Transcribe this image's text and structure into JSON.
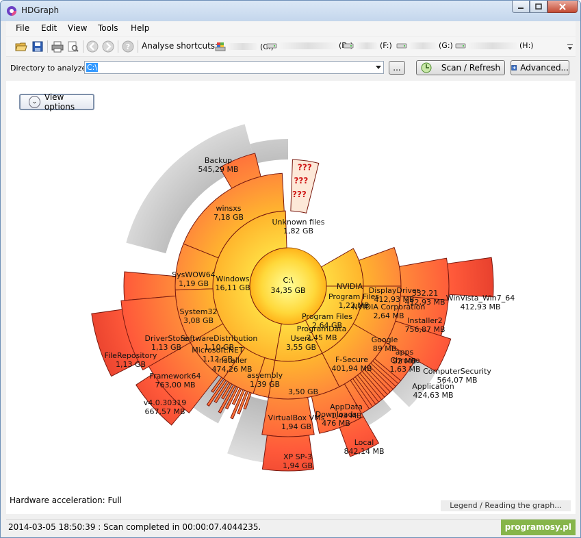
{
  "window": {
    "title": "HDGraph"
  },
  "menu": [
    "File",
    "Edit",
    "View",
    "Tools",
    "Help"
  ],
  "toolbar": {
    "shortcuts_label": "Analyse shortcuts:",
    "drives": [
      {
        "letter": "(C:)",
        "icon": "windows-drive-icon"
      },
      {
        "letter": "(D:)",
        "icon": "drive-icon"
      },
      {
        "letter": "(F:)",
        "icon": "drive-icon"
      },
      {
        "letter": "(G:)",
        "icon": "drive-icon"
      },
      {
        "letter": "(H:)",
        "icon": "drive-icon"
      }
    ]
  },
  "directory": {
    "label": "Directory to analyze :",
    "value": "C:\\",
    "browse_label": "...",
    "scan_label": "Scan / Refresh",
    "advanced_label": "Advanced..."
  },
  "view_options_label": "View options",
  "hardware_acceleration": "Hardware acceleration: Full",
  "legend_link": "Legend / Reading the graph...",
  "status": "2014-03-05 18:50:39 : Scan completed in 00:00:07.4044235.",
  "watermark": "programosy.pl",
  "graph": {
    "root": {
      "name": "C:\\",
      "size": "34,35 GB"
    },
    "labels": [
      {
        "name": "Backup",
        "size": "545,29 MB"
      },
      {
        "name": "winsxs",
        "size": "7,18 GB"
      },
      {
        "name": "Unknown files",
        "size": "1,82 GB"
      },
      {
        "name": "SysWOW64",
        "size": "1,19 GB"
      },
      {
        "name": "Windows",
        "size": "16,11 GB"
      },
      {
        "name": "System32",
        "size": "3,08 GB"
      },
      {
        "name": "DriverStore",
        "size": "1,13 GB"
      },
      {
        "name": "SoftwareDistribution",
        "size": "1,10 GB"
      },
      {
        "name": "FileRepository",
        "size": "1,13 GB"
      },
      {
        "name": "Microsoft.NET",
        "size": "1,12 GB"
      },
      {
        "name": "Installer",
        "size": "474,26 MB"
      },
      {
        "name": "Framework64",
        "size": "763,00 MB"
      },
      {
        "name": "assembly",
        "size": "1,39 GB"
      },
      {
        "name": "v4.0.30319",
        "size": "667,57 MB"
      },
      {
        "name": "Users",
        "size": "3,55 GB"
      },
      {
        "name": "",
        "size": "3,50 GB"
      },
      {
        "name": "VirtualBox VMs",
        "size": "1,94 GB"
      },
      {
        "name": "XP SP-3",
        "size": "1,94 GB"
      },
      {
        "name": "Downloads",
        "size": "476 MB"
      },
      {
        "name": "AppData",
        "size": "1,43 MB"
      },
      {
        "name": "Local",
        "size": "842,14 MB"
      },
      {
        "name": "Program Files",
        "size": "2,64 GB"
      },
      {
        "name": "ProgramData",
        "size": "2,45 MB"
      },
      {
        "name": "F-Secure",
        "size": "401,94 MB"
      },
      {
        "name": "Google",
        "size": "89 MB"
      },
      {
        "name": "Chrome",
        "size": "1,63 MB"
      },
      {
        "name": "apps",
        "size": "92 MB"
      },
      {
        "name": "ComputerSecurity",
        "size": "564,07 MB"
      },
      {
        "name": "Application",
        "size": "424,63 MB"
      },
      {
        "name": "NVIDIA Corporation",
        "size": "2,64 MB"
      },
      {
        "name": "Installer2",
        "size": "756,87 MB"
      },
      {
        "name": "NVIDIA",
        "size": ""
      },
      {
        "name": "Program Files",
        "size": "1,22 MB"
      },
      {
        "name": "DisplayDriver",
        "size": "412,93 MB"
      },
      {
        "name": "332.21",
        "size": "412,93 MB"
      },
      {
        "name": "WinVista_Win7_64",
        "size": "412,93 MB"
      }
    ]
  }
}
